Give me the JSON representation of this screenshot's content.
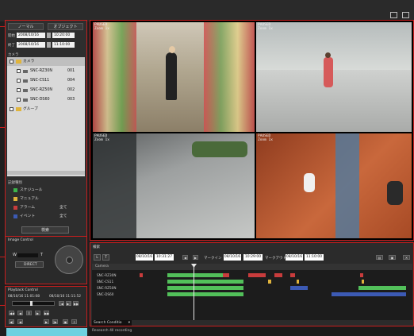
{
  "left": {
    "tabs": [
      "ノーマル",
      "オブジェクト"
    ],
    "start_label": "開始",
    "end_label": "終了",
    "start_date": "2008/10/16",
    "start_time": "10:20:00",
    "end_date": "2008/10/16",
    "end_time": "11:10:00",
    "camera_header": "カメラ",
    "tree_root": "カメラ",
    "cameras": [
      {
        "name": "SNC-RZ30N",
        "id": "001"
      },
      {
        "name": "SNC-CS11",
        "id": "004"
      },
      {
        "name": "SNC-RZ50N",
        "id": "002"
      },
      {
        "name": "SNC-DS60",
        "id": "003"
      }
    ],
    "group": "グループ",
    "record_type_label": "記録種別",
    "record_types": [
      {
        "label": "スケジュール",
        "color": "#3cb44b"
      },
      {
        "label": "マニュアル",
        "color": "#e0b43c"
      },
      {
        "label": "アラーム",
        "color": "#c83c3c",
        "extra": "全て"
      },
      {
        "label": "イベント",
        "color": "#3c5ab4",
        "extra": "全て"
      }
    ],
    "search_button": "検索"
  },
  "image_control": {
    "title": "Image Control",
    "w_label": "W",
    "t_label": "T",
    "direct_label": "DIRECT"
  },
  "playback": {
    "title": "Playback Control",
    "time_start": "08/10/16 11:01:08",
    "time_end": "08/10/16 11:11:52"
  },
  "videos": [
    {
      "status": "PAUSED",
      "zoom": "Zoom 1x"
    },
    {
      "status": "PAUSED",
      "zoom": "Zoom 1x"
    },
    {
      "status": "PAUSED",
      "zoom": "Zoom 1x"
    },
    {
      "status": "PAUSED",
      "zoom": "Zoom 1x"
    }
  ],
  "timeline": {
    "header": "検索",
    "btn_l": "L",
    "btn_t": "T",
    "date1": "08/10/16",
    "time1": "10:31:27",
    "markin_label": "マークイン",
    "markin_date": "08/10/16",
    "markin_time": "10:29:00",
    "markout_label": "マークアウト",
    "markout_date": "08/10/16",
    "markout_time": "11:10:00",
    "col_header": "Camera",
    "cameras": [
      "SNC-RZ30N",
      "SNC-CS11",
      "SNC-RZ50N",
      "SNC-DS60"
    ],
    "search_condition": "Search Conditio"
  },
  "status_bar": "Research 4ll recording"
}
